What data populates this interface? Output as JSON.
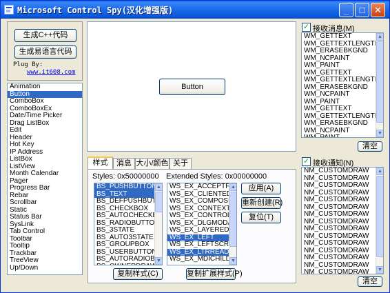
{
  "window": {
    "title": "Microsoft Control Spy(汉化增强版)"
  },
  "titlebar_buttons": [
    "_",
    "□",
    "✕"
  ],
  "codegen": {
    "cpp_label": "生成C++代码",
    "yi_label": "生成易语言代码",
    "plug_by": "Plug By:",
    "link": "www.it608.com"
  },
  "controls": {
    "items": [
      "Animation",
      "Button",
      "ComboBox",
      "ComboBoxEx",
      "Date/Time Picker",
      "Drag ListBox",
      "Edit",
      "Header",
      "Hot Key",
      "IP Address",
      "ListBox",
      "ListView",
      "Month Calendar",
      "Pager",
      "Progress Bar",
      "Rebar",
      "Scrollbar",
      "Static",
      "Status Bar",
      "SysLink",
      "Tab Control",
      "Toolbar",
      "Tooltip",
      "Trackbar",
      "TreeView",
      "Up/Down"
    ],
    "selected": "Button"
  },
  "preview": {
    "button_label": "Button"
  },
  "tabs": [
    "样式",
    "消息",
    "大小/颜色",
    "关于"
  ],
  "styles": {
    "label": "Styles: 0x50000000",
    "items": [
      "BS_PUSHBUTTON",
      "BS_TEXT",
      "BS_DEFPUSHBUTTON",
      "BS_CHECKBOX",
      "BS_AUTOCHECKBOX",
      "BS_RADIOBUTTON",
      "BS_3STATE",
      "BS_AUTO3STATE",
      "BS_GROUPBOX",
      "BS_USERBUTTON",
      "BS_AUTORADIOBUTTON",
      "BS_OWNERDRAW"
    ],
    "selected": [
      "BS_PUSHBUTTON",
      "BS_TEXT"
    ],
    "copy_label": "复制样式(C)"
  },
  "ex_styles": {
    "label": "Extended Styles: 0x00000000",
    "items": [
      "WS_EX_ACCEPTFILES",
      "WS_EX_CLIENTEDGE",
      "WS_EX_COMPOSITED",
      "WS_EX_CONTEXTHELP",
      "WS_EX_CONTROLPARENT",
      "WS_EX_DLGMODALFRAME",
      "WS_EX_LAYERED",
      "WS_EX_LEFT",
      "WS_EX_LEFTSCROLLBAR",
      "WS_EX_LTRREADING",
      "WS_EX_MDICHILD"
    ],
    "selected": [
      "WS_EX_LEFT",
      "WS_EX_LTRREADING"
    ],
    "copy_label": "复制扩展样式(P)"
  },
  "actions": {
    "apply": "应用(A)",
    "recreate": "重新创建(R)",
    "reset": "复位(T)"
  },
  "messages": {
    "label": "接收消息(M)",
    "items": [
      "WM_GETTEXT",
      "WM_GETTEXTLENGTH",
      "WM_ERASEBKGND",
      "WM_NCPAINT",
      "WM_PAINT",
      "WM_GETTEXT",
      "WM_GETTEXTLENGTH",
      "WM_ERASEBKGND",
      "WM_NCPAINT",
      "WM_PAINT",
      "WM_GETTEXT",
      "WM_GETTEXTLENGTH",
      "WM_ERASEBKGND",
      "WM_NCPAINT",
      "WM_PAINT"
    ],
    "clear": "清空"
  },
  "notifications": {
    "label": "接收通知(N)",
    "items": [
      "NM_CUSTOMDRAW",
      "NM_CUSTOMDRAW",
      "NM_CUSTOMDRAW",
      "NM_CUSTOMDRAW",
      "NM_CUSTOMDRAW",
      "NM_CUSTOMDRAW",
      "NM_CUSTOMDRAW",
      "NM_CUSTOMDRAW",
      "NM_CUSTOMDRAW",
      "NM_CUSTOMDRAW",
      "NM_CUSTOMDRAW",
      "NM_CUSTOMDRAW",
      "NM_CUSTOMDRAW",
      "NM_CUSTOMDRAW",
      "NM_CUSTOMDRAW",
      "NM_CUSTOMDRAW"
    ],
    "clear": "清空"
  },
  "icons": {
    "app": "app-icon",
    "check": "check-mark-icon",
    "scroll_up": "scroll-up-arrow-icon",
    "scroll_down": "scroll-down-arrow-icon"
  },
  "colors": {
    "selection": "#316ac5",
    "titlebar": "#0a5de8",
    "window_bg": "#ece9d8"
  }
}
